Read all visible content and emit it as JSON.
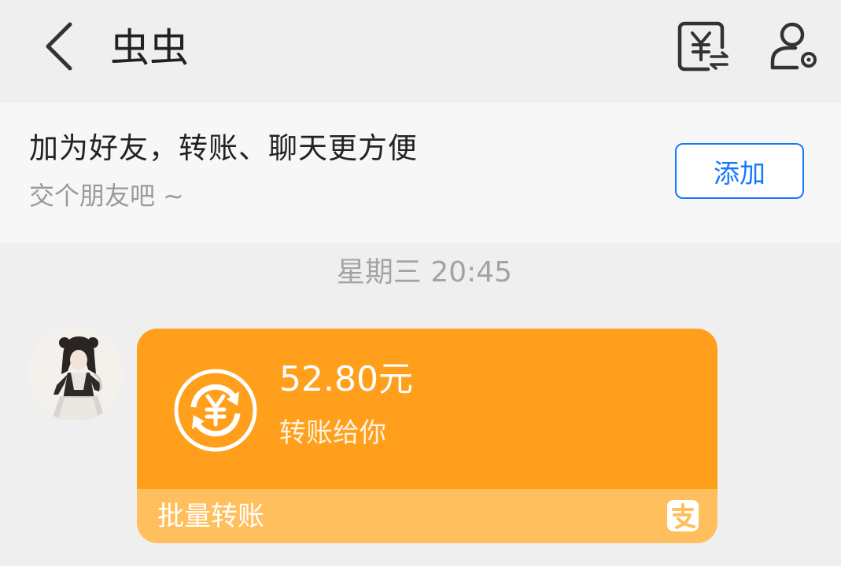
{
  "header": {
    "back_icon": "chevron-left-icon",
    "title": "虫虫",
    "transfer_icon": "yuan-transfer-icon",
    "profile_icon": "user-settings-icon"
  },
  "banner": {
    "title": "加为好友，转账、聊天更方便",
    "subtitle": "交个朋友吧 ~",
    "add_button": "添加"
  },
  "chat": {
    "timestamp": "星期三 20:45",
    "message": {
      "amount": "52.80元",
      "description": "转账给你",
      "footer_label": "批量转账",
      "icon": "yuan-coin-refresh-icon",
      "brand_icon": "alipay-icon"
    }
  },
  "colors": {
    "accent_blue": "#1677ff",
    "card_orange": "#ff9f1c",
    "card_footer": "#ffbf5c",
    "background": "#efefef"
  }
}
